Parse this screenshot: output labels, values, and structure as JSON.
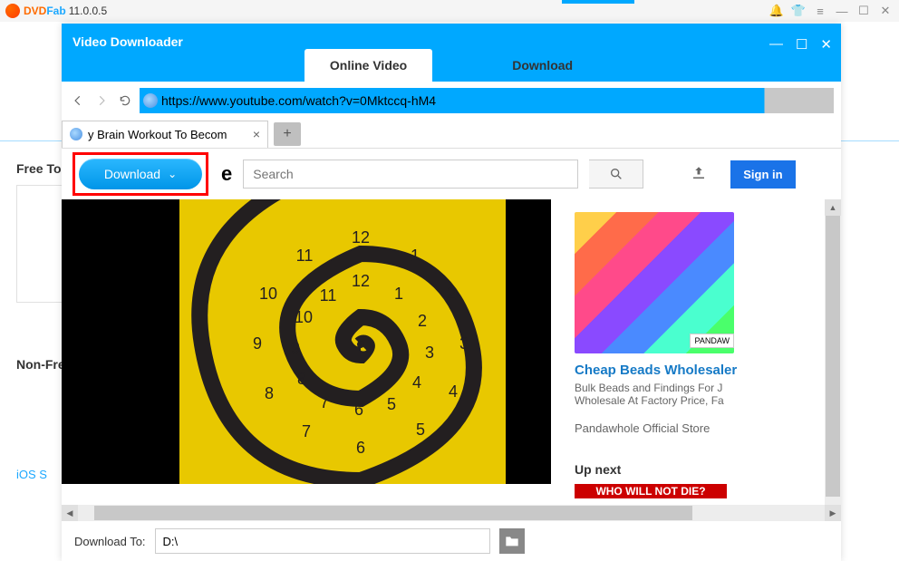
{
  "titlebar": {
    "brand1": "DVD",
    "brand2": "Fab",
    "version": "11.0.0.5"
  },
  "bg": {
    "row1": "Free To",
    "row2": "Non-Fre",
    "link": "iOS S"
  },
  "modal": {
    "title": "Video Downloader",
    "tab_online": "Online Video",
    "tab_download": "Download"
  },
  "url": "https://www.youtube.com/watch?v=0Mktccq-hM4",
  "page_tab": "y Brain Workout To Becom",
  "download_btn": "Download",
  "yt": {
    "search_placeholder": "Search",
    "signin": "Sign in",
    "logo_frag": "e",
    "ad_title": "Cheap Beads Wholesaler",
    "ad_desc": "Bulk Beads and Findings For J\nWholesale At Factory Price, Fa",
    "ad_store": "Pandawhole Official Store",
    "ad_badge": "PANDAW",
    "upnext": "Up next",
    "upnext_title": "WHO WILL NOT DIE?"
  },
  "download_to": {
    "label": "Download To:",
    "path": "D:\\"
  }
}
